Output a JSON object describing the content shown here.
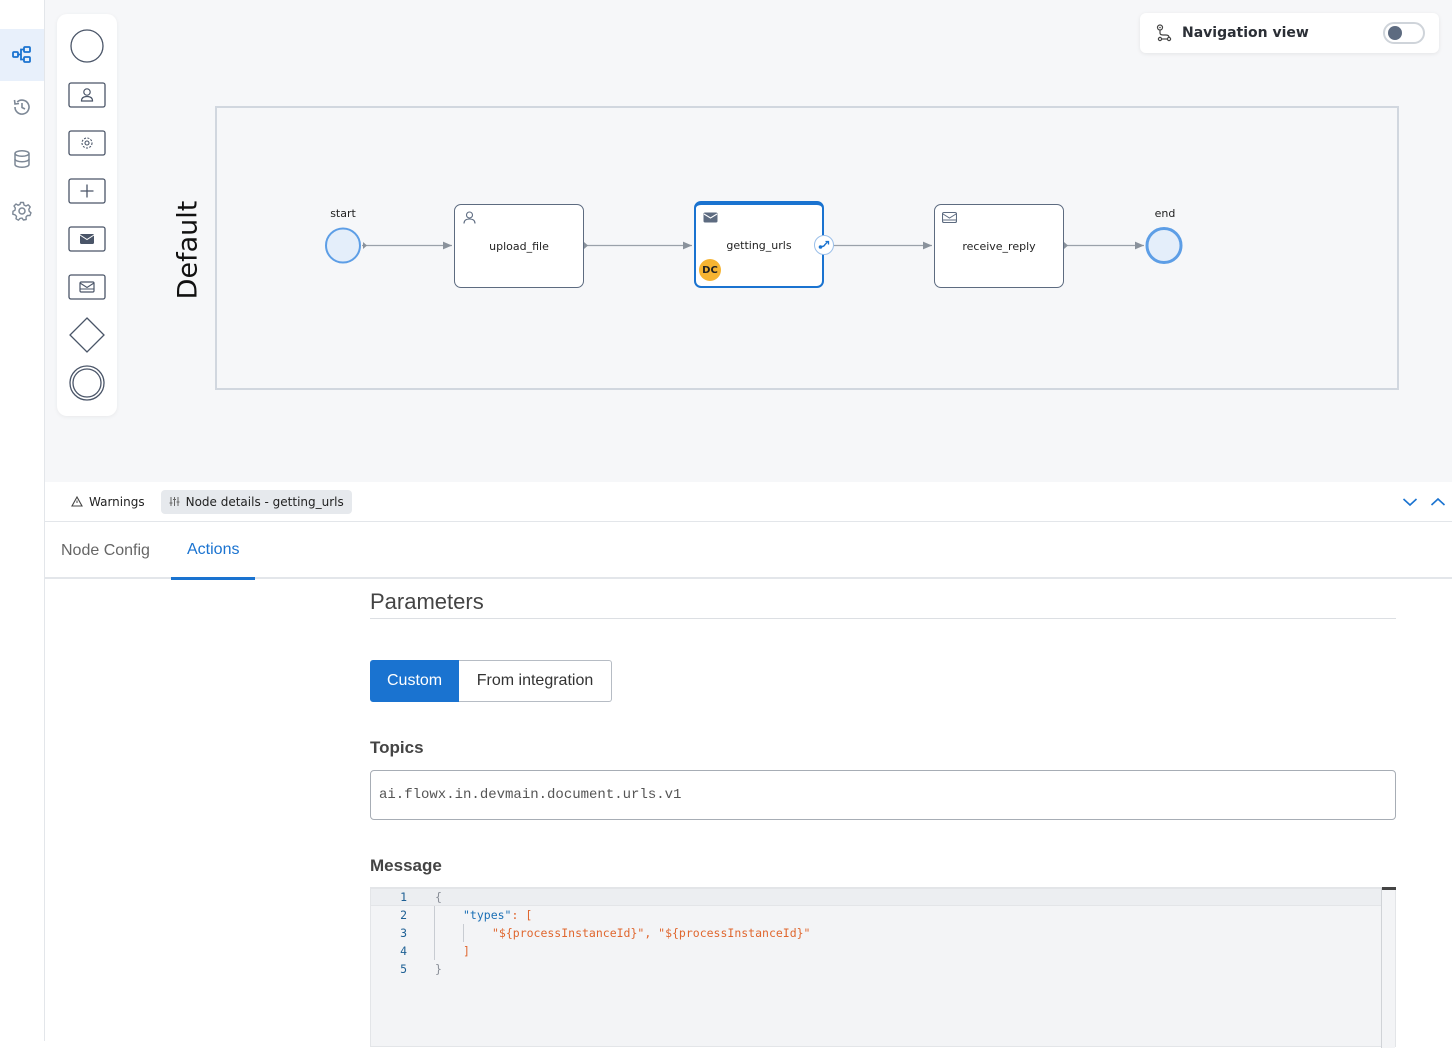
{
  "sidebar": {
    "items": [
      {
        "name": "process-designer",
        "icon": "diagram-icon",
        "active": true
      },
      {
        "name": "history",
        "icon": "history-icon",
        "active": false
      },
      {
        "name": "data-model",
        "icon": "database-icon",
        "active": false
      },
      {
        "name": "settings",
        "icon": "gear-icon",
        "active": false
      }
    ]
  },
  "palette": {
    "items": [
      {
        "name": "start-event",
        "icon": "circle-icon"
      },
      {
        "name": "user-task",
        "icon": "user-task-icon"
      },
      {
        "name": "service-task",
        "icon": "service-task-icon"
      },
      {
        "name": "subprocess",
        "icon": "plus-box-icon"
      },
      {
        "name": "send-message-task",
        "icon": "envelope-filled-icon"
      },
      {
        "name": "receive-message-task",
        "icon": "envelope-open-icon"
      },
      {
        "name": "gateway",
        "icon": "diamond-icon"
      },
      {
        "name": "end-event",
        "icon": "double-circle-icon"
      }
    ]
  },
  "navigation_view": {
    "label": "Navigation view",
    "enabled": false
  },
  "diagram": {
    "lane_label": "Default",
    "nodes": [
      {
        "id": "start",
        "label": "start",
        "type": "start-event"
      },
      {
        "id": "upload_file",
        "label": "upload_file",
        "type": "user-task"
      },
      {
        "id": "getting_urls",
        "label": "getting_urls",
        "type": "send-message-task",
        "selected": true,
        "badge": "DC"
      },
      {
        "id": "receive_reply",
        "label": "receive_reply",
        "type": "receive-message-task"
      },
      {
        "id": "end",
        "label": "end",
        "type": "end-event"
      }
    ],
    "accent_color": "#1a73d0"
  },
  "bottom_panel": {
    "tabs": [
      {
        "label": "Warnings",
        "icon": "warning-icon",
        "active": false
      },
      {
        "label": "Node details - getting_urls",
        "icon": "sliders-icon",
        "active": true
      }
    ],
    "sub_tabs": [
      {
        "label": "Node Config",
        "active": false
      },
      {
        "label": "Actions",
        "active": true
      }
    ],
    "parameters": {
      "title": "Parameters",
      "mode_options": [
        "Custom",
        "From integration"
      ],
      "selected_mode": "Custom",
      "topics_label": "Topics",
      "topics_value": "ai.flowx.in.devmain.document.urls.v1",
      "message_label": "Message",
      "message_lines": [
        {
          "n": "1",
          "text": "{"
        },
        {
          "n": "2",
          "key": "\"types\"",
          "rest": ": ["
        },
        {
          "n": "3",
          "text": "\"${processInstanceId}\", \"${processInstanceId}\""
        },
        {
          "n": "4",
          "text": "]"
        },
        {
          "n": "5",
          "text": "}"
        }
      ]
    }
  }
}
